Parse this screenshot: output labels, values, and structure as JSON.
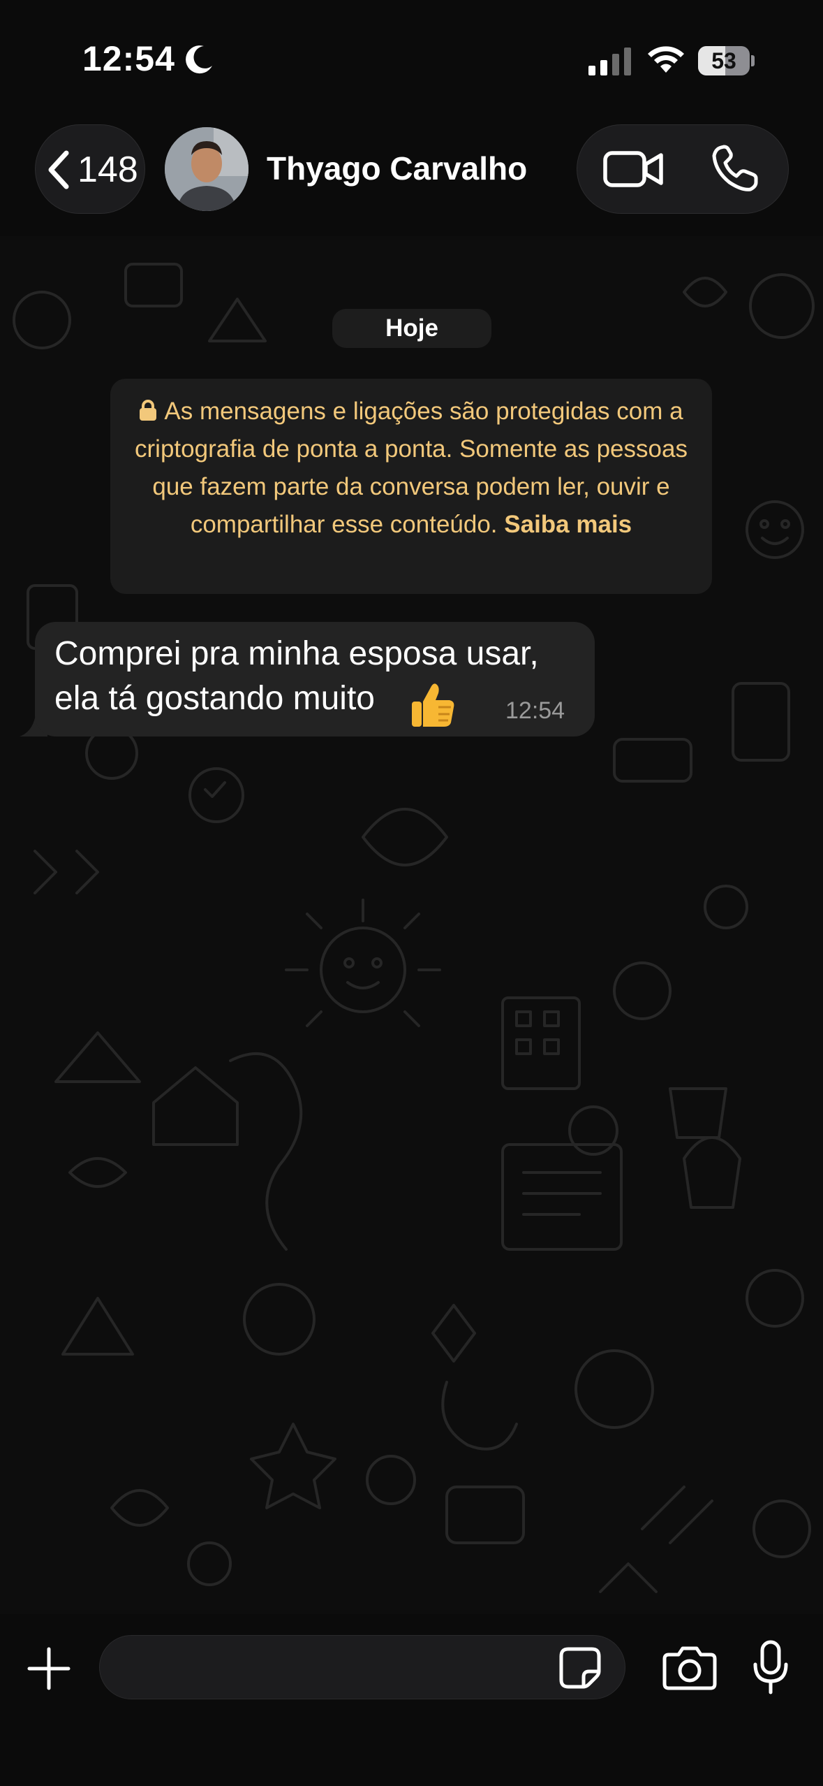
{
  "status_bar": {
    "time": "12:54",
    "battery_level": "53",
    "battery_fraction": 0.53,
    "icons": [
      "moon-icon",
      "cellular-signal-icon",
      "wifi-icon",
      "battery-icon"
    ]
  },
  "header": {
    "back_count": "148",
    "contact_name": "Thyago Carvalho",
    "icons": [
      "chevron-left-icon",
      "video-call-icon",
      "phone-call-icon"
    ]
  },
  "chat": {
    "date_label": "Hoje",
    "encryption_notice": {
      "text": "As mensagens e ligações são protegidas com a criptografia de ponta a ponta. Somente as pessoas que fazem parte da conversa podem ler, ouvir e compartilhar esse conteúdo.",
      "link": "Saiba mais",
      "color": "#f2c87b"
    },
    "messages": [
      {
        "text": "Comprei pra minha esposa usar,\nela tá gostando muito",
        "emoji": "thumbs-up",
        "time": "12:54"
      }
    ]
  },
  "input_bar": {
    "placeholder": "",
    "icons": [
      "plus-icon",
      "sticker-icon",
      "camera-icon",
      "microphone-icon"
    ]
  },
  "colors": {
    "background": "#0b0b0b",
    "bubble": "#232323",
    "pill": "#1d1d1d",
    "accent": "#f2c87b"
  }
}
